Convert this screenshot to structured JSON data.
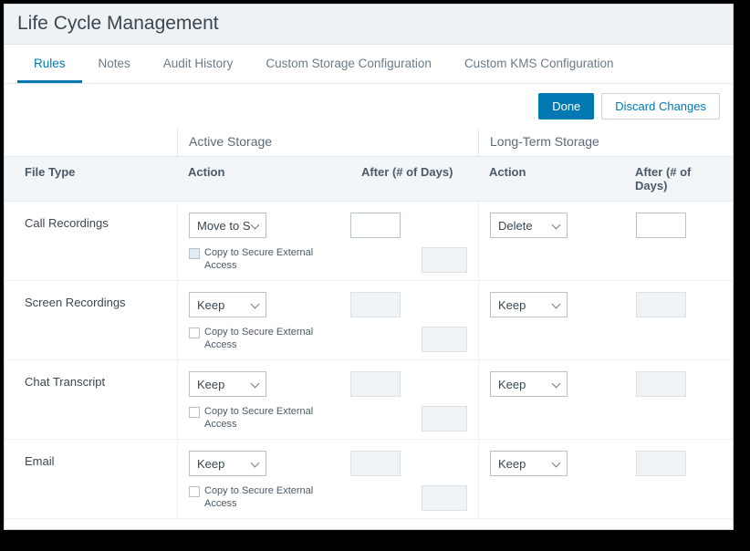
{
  "page_title": "Life Cycle Management",
  "tabs": [
    {
      "label": "Rules",
      "active": true
    },
    {
      "label": "Notes"
    },
    {
      "label": "Audit History"
    },
    {
      "label": "Custom Storage Configuration"
    },
    {
      "label": "Custom KMS Configuration"
    }
  ],
  "buttons": {
    "done": "Done",
    "discard": "Discard Changes"
  },
  "storage_headers": {
    "active": "Active Storage",
    "long": "Long-Term Storage"
  },
  "columns": {
    "file_type": "File Type",
    "action": "Action",
    "after": "After (# of Days)"
  },
  "checkbox_label": "Copy to Secure External Access",
  "rows": [
    {
      "file_type": "Call Recordings",
      "active": {
        "action": "Move to S",
        "after": "",
        "after_disabled": false,
        "copy_checked": true,
        "copy_after": "",
        "copy_after_disabled": true
      },
      "long": {
        "action": "Delete",
        "after": "",
        "after_disabled": false
      }
    },
    {
      "file_type": "Screen Recordings",
      "active": {
        "action": "Keep",
        "after": "",
        "after_disabled": true,
        "copy_checked": false,
        "copy_after": "",
        "copy_after_disabled": true
      },
      "long": {
        "action": "Keep",
        "after": "",
        "after_disabled": true
      }
    },
    {
      "file_type": "Chat Transcript",
      "active": {
        "action": "Keep",
        "after": "",
        "after_disabled": true,
        "copy_checked": false,
        "copy_after": "",
        "copy_after_disabled": true
      },
      "long": {
        "action": "Keep",
        "after": "",
        "after_disabled": true
      }
    },
    {
      "file_type": "Email",
      "active": {
        "action": "Keep",
        "after": "",
        "after_disabled": true,
        "copy_checked": false,
        "copy_after": "",
        "copy_after_disabled": true
      },
      "long": {
        "action": "Keep",
        "after": "",
        "after_disabled": true
      }
    }
  ]
}
